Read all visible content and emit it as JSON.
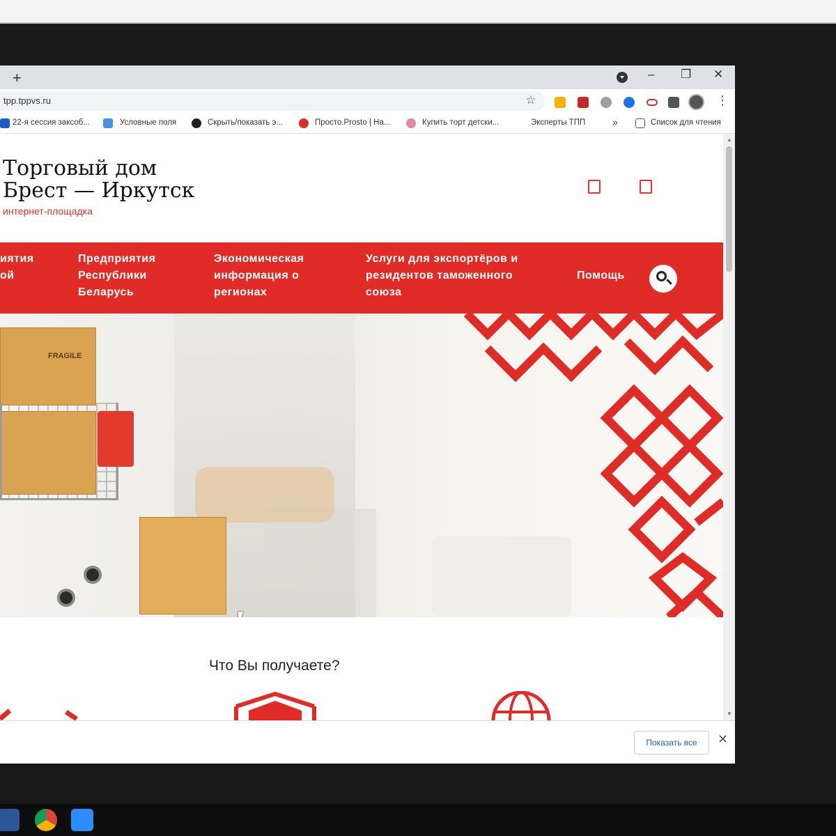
{
  "browser": {
    "new_tab": "+",
    "window_controls": {
      "minimize": "–",
      "restore": "❐",
      "close": "✕"
    },
    "url": "tpp.tppvs.ru",
    "bookmarks": [
      {
        "label": "22-я сессия заксоб...",
        "icon_color": "#1e5bc6"
      },
      {
        "label": "Условные поля",
        "icon_color": "#4a90e2"
      },
      {
        "label": "Скрыть/показать э...",
        "icon_color": "#222222"
      },
      {
        "label": "Просто.Prosto | На...",
        "icon_color": "#d93025"
      },
      {
        "label": "Купить торт детски...",
        "icon_color": "#e48aa0"
      },
      {
        "label": "Эксперты ТПП",
        "icon_color": ""
      }
    ],
    "bookmarks_more": "»",
    "reading_list": "Список для чтения"
  },
  "site": {
    "logo_line1": "Торговый дом",
    "logo_line2": "Брест — Иркутск",
    "logo_sub": "интернет-площадка",
    "nav": [
      {
        "label": "иятия\nой\n"
      },
      {
        "label": "Предприятия\nРеспублики\nБеларусь"
      },
      {
        "label": "Экономическая\nинформация о\nрегионах"
      },
      {
        "label": "Услуги для экспортёров и\nрезидентов таможенного\nсоюза"
      },
      {
        "label": "Помощь"
      }
    ],
    "section_title": "Что Вы получаете?",
    "accent_color": "#e02b27"
  },
  "hero": {
    "box_label": "FRAGILE"
  },
  "downloads": {
    "show_all": "Показать все",
    "close": "✕"
  }
}
